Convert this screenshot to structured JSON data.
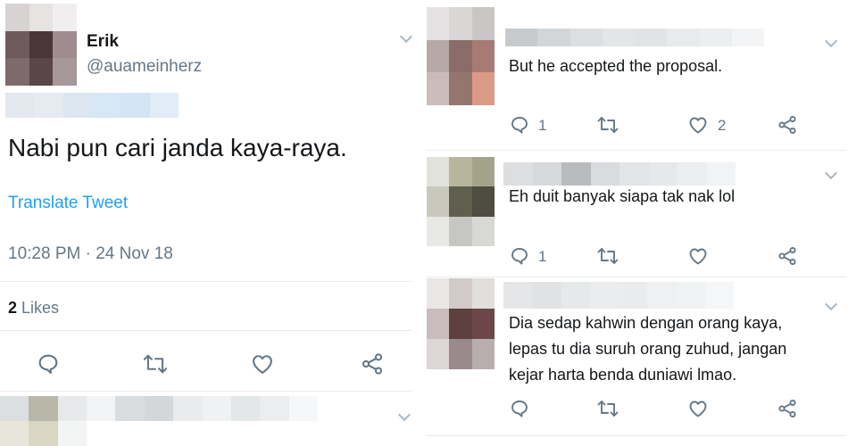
{
  "main_tweet": {
    "author_name": "Erik",
    "author_handle": "@auameinherz",
    "text": "Nabi pun cari janda kaya-raya.",
    "translate_label": "Translate Tweet",
    "timestamp": "10:28 PM · 24 Nov 18",
    "likes_count": "2",
    "likes_label": "Likes"
  },
  "replies": [
    {
      "text": "But he accepted the proposal.",
      "reply_count": "1",
      "like_count": "2"
    },
    {
      "text": "Eh duit banyak siapa tak nak lol",
      "reply_count": "1",
      "like_count": ""
    },
    {
      "text_lines": [
        "Dia sedap kahwin dengan orang kaya,",
        "lepas tu dia suruh orang zuhud, jangan",
        "kejar harta benda duniawi lmao."
      ],
      "reply_count": "",
      "like_count": ""
    }
  ],
  "icons": [
    "reply-icon",
    "retweet-icon",
    "like-icon",
    "share-icon",
    "chevron-down-icon"
  ],
  "colors": {
    "link": "#1da1f2",
    "secondary_text": "#657786",
    "icon": "#657786",
    "divider": "#e6ecf0"
  }
}
